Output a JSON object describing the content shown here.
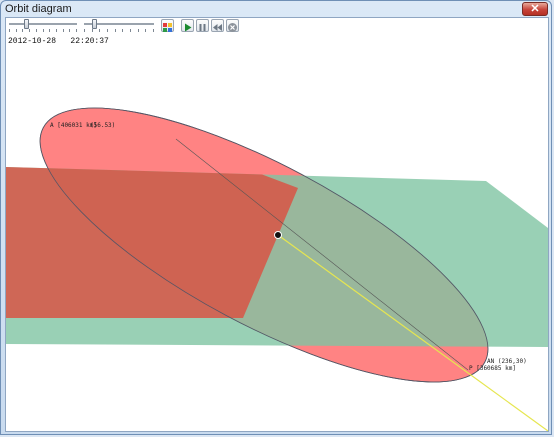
{
  "window": {
    "title": "Orbit diagram",
    "close_glyph": "✕"
  },
  "toolbar": {
    "speed_slider_level": 0.24,
    "time_slider_level": 0.12,
    "buttons": [
      {
        "name": "view-color-icon"
      },
      {
        "name": "play-icon",
        "color": "#1b8a2f"
      },
      {
        "name": "pause-icon"
      },
      {
        "name": "rewind-icon"
      },
      {
        "name": "stop-icon"
      }
    ]
  },
  "timestamp": "2012-10-28   22:20:37",
  "diagram": {
    "colors": {
      "plane": "#7fc4a2",
      "orbit_fill": "#ff5a5a",
      "node_line": "#e6e650",
      "apsis_line": "#555555"
    },
    "labels": {
      "apoapsis": "A [406031 km]",
      "apoapsis_overlap": "(56.53)",
      "ascending_node": "AN (236,30)",
      "periapsis": "P [360685 km]"
    }
  }
}
